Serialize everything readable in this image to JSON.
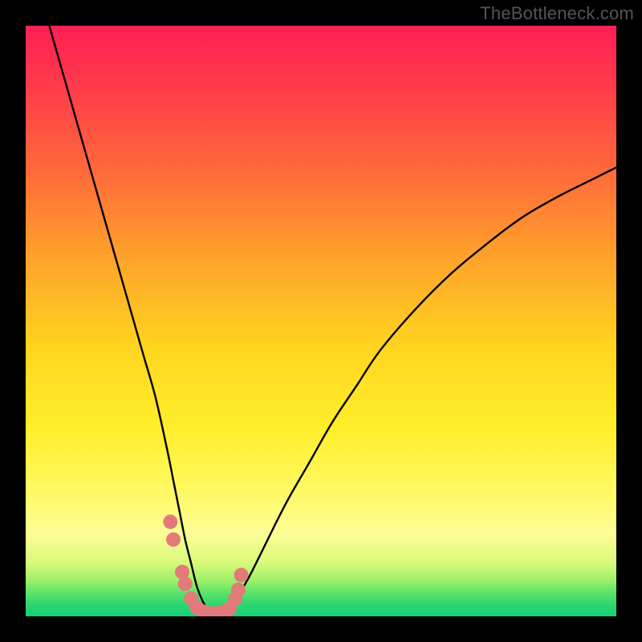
{
  "watermark": "TheBottleneck.com",
  "chart_data": {
    "type": "line",
    "title": "",
    "xlabel": "",
    "ylabel": "",
    "xlim": [
      0,
      100
    ],
    "ylim": [
      0,
      100
    ],
    "grid": false,
    "legend": false,
    "annotations": [],
    "series": [
      {
        "name": "bottleneck-curve",
        "color": "#000000",
        "x": [
          4,
          6,
          8,
          10,
          12,
          14,
          16,
          18,
          20,
          22,
          24,
          25,
          26,
          27,
          28,
          29,
          30,
          31,
          32,
          33,
          34,
          35,
          36,
          38,
          40,
          44,
          48,
          52,
          56,
          60,
          66,
          72,
          78,
          84,
          90,
          96,
          100
        ],
        "values": [
          100,
          93,
          86,
          79,
          72,
          65,
          58,
          51,
          44,
          37,
          28,
          23,
          18,
          13,
          9,
          5,
          2.5,
          1,
          0.5,
          0.5,
          1,
          2,
          3.5,
          7,
          11,
          19,
          26,
          33,
          39,
          45,
          52,
          58,
          63,
          67.5,
          71,
          74,
          76
        ]
      }
    ],
    "markers": [
      {
        "name": "curve-dots",
        "color": "#e27a7a",
        "x": [
          24.5,
          25.0,
          26.5,
          27.0,
          28.0,
          29.0,
          30.0,
          31.0,
          32.0,
          33.0,
          34.0,
          34.5,
          35.5,
          36.0,
          36.5
        ],
        "values": [
          16.0,
          13.0,
          7.5,
          5.5,
          3.0,
          1.5,
          0.8,
          0.5,
          0.5,
          0.6,
          1.0,
          1.3,
          3.0,
          4.5,
          7.0
        ]
      }
    ],
    "gradient_stops": [
      {
        "pos": 0,
        "color": "#ff1f55"
      },
      {
        "pos": 10,
        "color": "#ff3a4a"
      },
      {
        "pos": 25,
        "color": "#ff6b3a"
      },
      {
        "pos": 40,
        "color": "#ffa529"
      },
      {
        "pos": 55,
        "color": "#ffd61f"
      },
      {
        "pos": 68,
        "color": "#ffee2a"
      },
      {
        "pos": 78,
        "color": "#fff85e"
      },
      {
        "pos": 86,
        "color": "#fdfd96"
      },
      {
        "pos": 91,
        "color": "#d8f97a"
      },
      {
        "pos": 94,
        "color": "#9bf06a"
      },
      {
        "pos": 96,
        "color": "#5de36a"
      },
      {
        "pos": 98,
        "color": "#2dd66e"
      },
      {
        "pos": 100,
        "color": "#16cf78"
      }
    ]
  }
}
